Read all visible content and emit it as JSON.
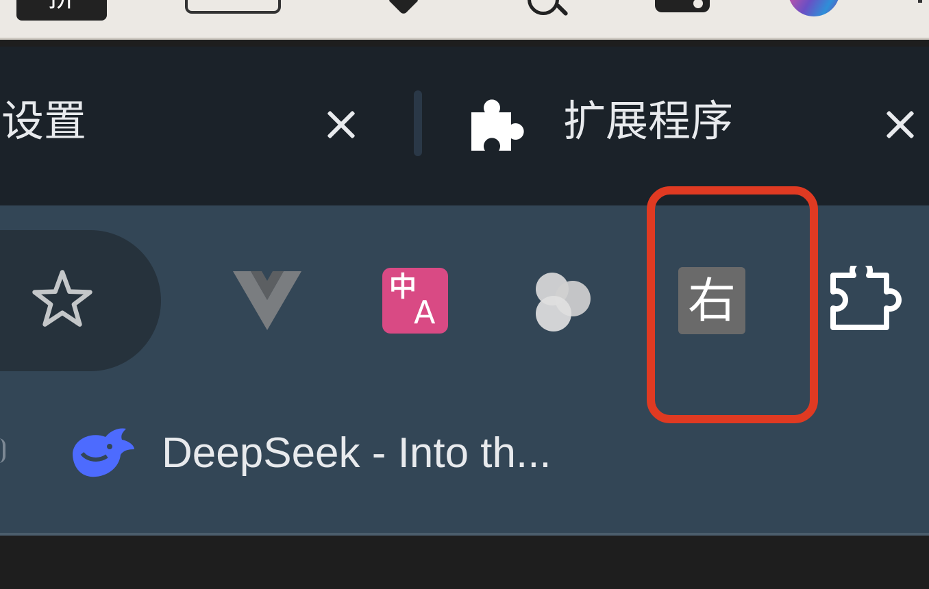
{
  "menubar": {
    "input_method_label": "拼"
  },
  "tabs": [
    {
      "title": "设置",
      "icon": ""
    },
    {
      "title": "扩展程序",
      "icon": "puzzle-piece-icon"
    }
  ],
  "toolbar": {
    "bookmark_star_icon": "star-outline-icon",
    "extensions": [
      {
        "name": "vue-devtools-icon",
        "label": ""
      },
      {
        "name": "translate-icon",
        "label_zh": "中",
        "label_en": "A"
      },
      {
        "name": "circles-extension-icon",
        "label": ""
      },
      {
        "name": "right-click-extension-icon",
        "label": "右"
      }
    ],
    "extensions_menu_icon": "puzzle-outline-icon",
    "highlight_color": "#e03a22"
  },
  "bookmarks": [
    {
      "title": "DeepSeek - Into th...",
      "icon": "deepseek-whale-icon",
      "icon_color": "#4d6bfe"
    }
  ],
  "colors": {
    "tabstrip": "#1b2229",
    "toolbar": "#334656",
    "text": "#e8eaed"
  }
}
